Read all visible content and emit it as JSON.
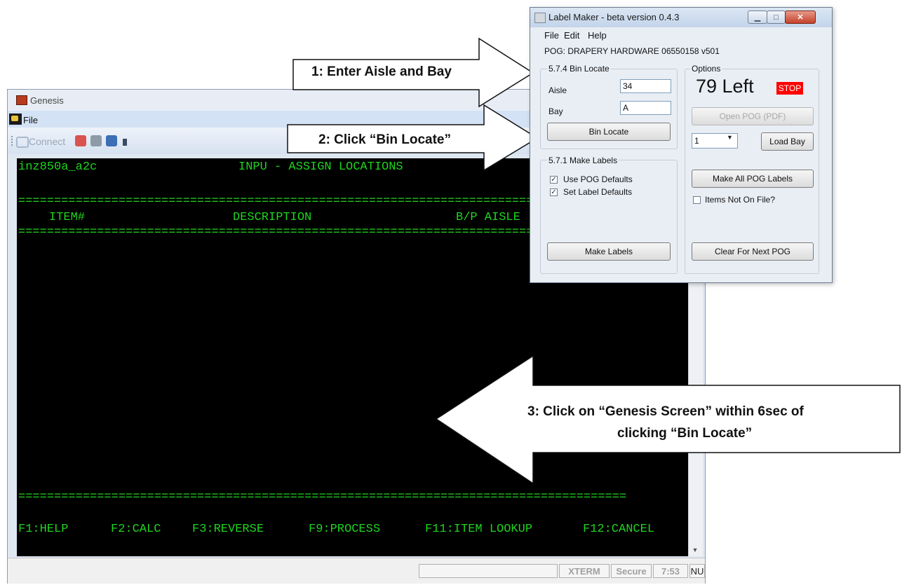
{
  "genesis": {
    "title": "Genesis",
    "menu": {
      "file": "File"
    },
    "toolbar": {
      "connect": "Connect"
    },
    "terminal": {
      "program": "inz850a_a2c",
      "screen_title": "INPU - ASSIGN LOCATIONS",
      "separator": "=====================================================================================",
      "columns": {
        "item": "ITEM#",
        "description": "DESCRIPTION",
        "bp_aisle": "B/P AISLE"
      },
      "function_keys": [
        "F1:HELP",
        "F2:CALC",
        "F3:REVERSE",
        "F9:PROCESS",
        "F11:ITEM LOOKUP",
        "F12:CANCEL"
      ]
    },
    "statusbar": {
      "xterm": "XTERM",
      "secure": "Secure",
      "time": "7:53",
      "mode": "NU"
    }
  },
  "label_maker": {
    "title": "Label Maker - beta version 0.4.3",
    "menu": {
      "file": "File",
      "edit": "Edit",
      "help": "Help"
    },
    "pog": "POG: DRAPERY HARDWARE 06550158 v501",
    "bin_locate": {
      "group_label": "5.7.4 Bin Locate",
      "aisle_label": "Aisle",
      "aisle_value": "34",
      "bay_label": "Bay",
      "bay_value": "A",
      "button": "Bin Locate"
    },
    "make_labels": {
      "group_label": "5.7.1 Make Labels",
      "use_pog_defaults": "Use POG Defaults",
      "set_label_defaults": "Set Label Defaults",
      "button": "Make Labels"
    },
    "options": {
      "group_label": "Options",
      "left_count": "79 Left",
      "stop": "STOP",
      "open_pog": "Open POG (PDF)",
      "bay_select": "1",
      "load_bay": "Load Bay",
      "make_all": "Make All POG Labels",
      "items_not_on_file": "Items Not On File?",
      "clear": "Clear For Next POG"
    },
    "stop_color": "#ff0000"
  },
  "callouts": {
    "step1": "1: Enter Aisle and Bay",
    "step2": "2: Click “Bin Locate”",
    "step3_line1": "3: Click on “Genesis Screen” within 6sec of",
    "step3_line2": "clicking “Bin Locate”"
  }
}
